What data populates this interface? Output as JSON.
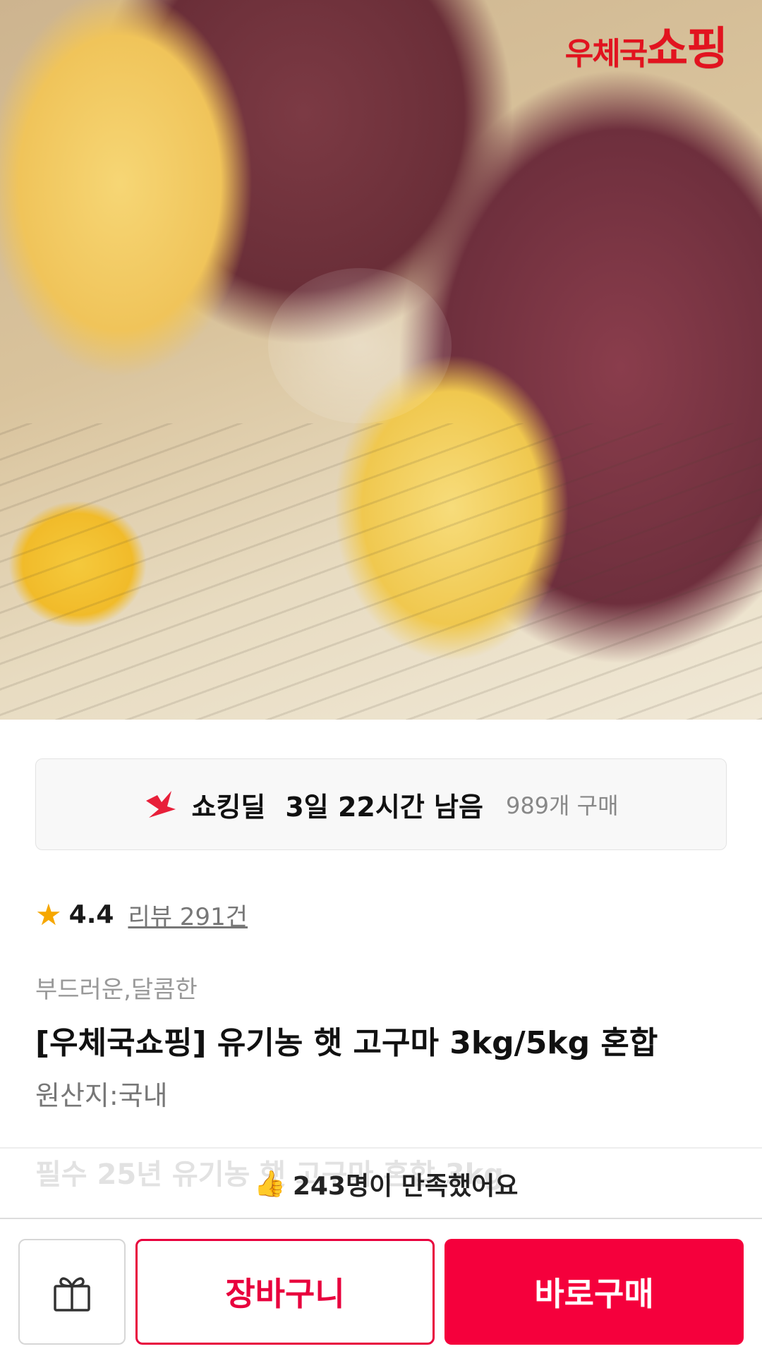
{
  "hero": {
    "brand_small": "우체국",
    "brand_big": "쇼핑"
  },
  "deal": {
    "label": "쇼킹딜",
    "remaining": "3일 22시간 남음",
    "purchase_count": "989개 구매",
    "accent_color": "#e8203a"
  },
  "rating": {
    "star": "★",
    "score": "4.4",
    "reviews_link": "리뷰 291건"
  },
  "product": {
    "tags": "부드러운,달콤한",
    "title": "[우체국쇼핑] 유기농 햇 고구마 3kg/5kg 혼합",
    "origin": "원산지:국내"
  },
  "option_preview": {
    "text": "필수   25년 유기농 햇 고구마 혼합 3kg"
  },
  "satisfaction": {
    "icon": "thumbs-up-icon",
    "text": "243명이 만족했어요"
  },
  "bottom_bar": {
    "gift_icon": "gift-icon",
    "cart_label": "장바구니",
    "buy_label": "바로구매",
    "accent_color": "#f5003c"
  }
}
